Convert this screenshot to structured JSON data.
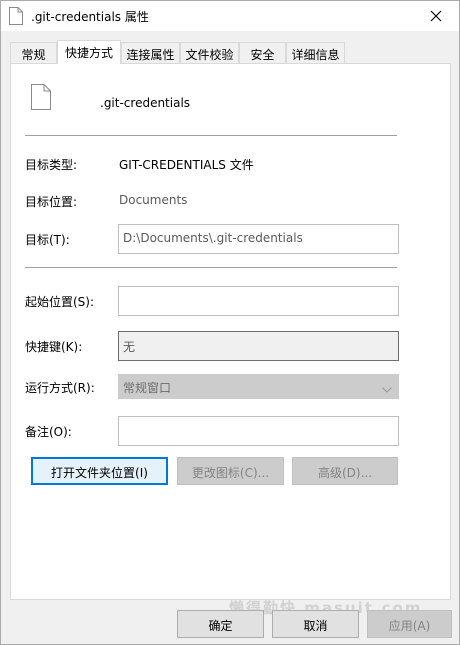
{
  "window": {
    "title": ".git-credentials 属性"
  },
  "tabs": [
    {
      "label": "常规",
      "active": false
    },
    {
      "label": "快捷方式",
      "active": true
    },
    {
      "label": "连接属性",
      "active": false
    },
    {
      "label": "文件校验",
      "active": false
    },
    {
      "label": "安全",
      "active": false
    },
    {
      "label": "详细信息",
      "active": false
    }
  ],
  "shortcut": {
    "file_name": ".git-credentials",
    "target_type_label": "目标类型:",
    "target_type_value": "GIT-CREDENTIALS 文件",
    "target_location_label": "目标位置:",
    "target_location_value": "Documents",
    "target_label": "目标(T):",
    "target_value": "D:\\Documents\\.git-credentials",
    "start_in_label": "起始位置(S):",
    "start_in_value": "",
    "hotkey_label": "快捷键(K):",
    "hotkey_value": "无",
    "run_label": "运行方式(R):",
    "run_value": "常规窗口",
    "comment_label": "备注(O):",
    "comment_value": ""
  },
  "action_buttons": {
    "open_location": "打开文件夹位置(I)",
    "change_icon": "更改图标(C)...",
    "advanced": "高级(D)..."
  },
  "dialog_buttons": {
    "ok": "确定",
    "cancel": "取消",
    "apply": "应用(A)"
  },
  "watermark": "懒得勤快 masuit.com",
  "colors": {
    "focus_border": "#0078d7",
    "panel_bg": "#ffffff",
    "window_bg": "#f0f0f0"
  }
}
